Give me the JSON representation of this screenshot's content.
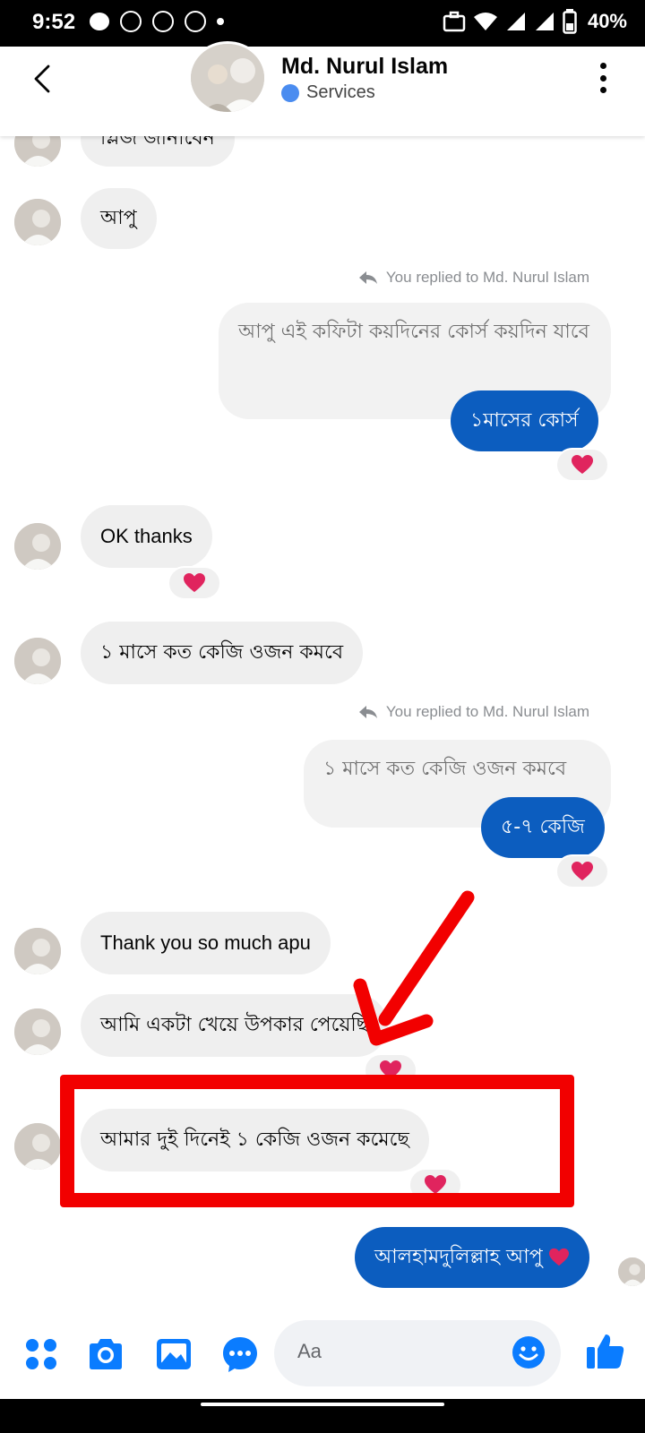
{
  "status_bar": {
    "time": "9:52",
    "battery": "40%"
  },
  "header": {
    "name": "Md. Nurul Islam",
    "subtitle": "Services",
    "back_icon": "back-chevron-icon",
    "more_icon": "more-vertical-icon"
  },
  "messages": {
    "m0": "প্লিজ জানাবেন",
    "m1": "আপু",
    "reply_note_1": "You replied to Md. Nurul Islam",
    "quote_1": "আপু এই কফিটা কয়দিনের কোর্স কয়দিন যাবে",
    "out_1": "১মাসের কোর্স",
    "m2": "OK thanks",
    "m3": "১ মাসে কত কেজি ওজন কমবে",
    "reply_note_2": "You replied to Md. Nurul Islam",
    "quote_2": "১ মাসে কত কেজি ওজন কমবে",
    "out_2": "৫-৭ কেজি",
    "m4": "Thank you so much apu",
    "m5": "আমি একটা খেয়ে উপকার পেয়েছি",
    "m6": "আমার দুই দিনেই ১ কেজি ওজন কমেছে",
    "out_3": "আলহামদুলিল্লাহ আপু"
  },
  "reaction_icon": "heart-icon",
  "colors": {
    "outgoing_bubble": "#0c5dbf",
    "incoming_bubble": "#efefef",
    "messenger_blue": "#0a7cff",
    "heart": "#e0245e",
    "annotation_red": "#f20000"
  },
  "composer": {
    "placeholder": "Aa",
    "icons": [
      "apps-icon",
      "camera-icon",
      "gallery-icon",
      "chat-bubble-icon",
      "emoji-icon",
      "like-icon"
    ]
  }
}
